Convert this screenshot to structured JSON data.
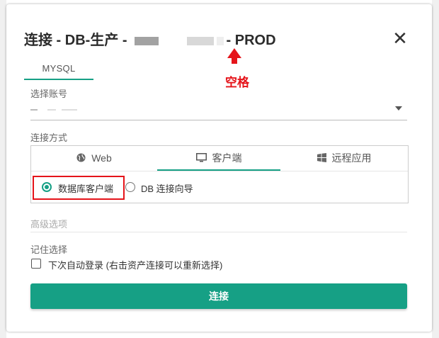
{
  "dialog": {
    "title_prefix": "连接 - DB-生产 -",
    "title_suffix": "- PROD",
    "close_label": "✕"
  },
  "annotation": {
    "label": "空格",
    "color": "#e5141a"
  },
  "db_tab": {
    "label": "MYSQL",
    "active": true
  },
  "account": {
    "label": "选择账号",
    "value": ""
  },
  "connection": {
    "label": "连接方式",
    "tabs": [
      {
        "label": "Web",
        "icon": "globe-icon",
        "active": false
      },
      {
        "label": "客户端",
        "icon": "monitor-icon",
        "active": true
      },
      {
        "label": "远程应用",
        "icon": "windows-icon",
        "active": false
      }
    ],
    "options": [
      {
        "label": "数据库客户端",
        "selected": true
      },
      {
        "label": "DB 连接向导",
        "selected": false
      }
    ]
  },
  "advanced": {
    "label": "高级选项"
  },
  "remember": {
    "label": "记住选择",
    "checkbox_label": "下次自动登录 (右击资产连接可以重新选择)",
    "checked": false
  },
  "connect_button": {
    "label": "连接"
  },
  "colors": {
    "accent": "#16a085",
    "highlight": "#e5141a"
  }
}
